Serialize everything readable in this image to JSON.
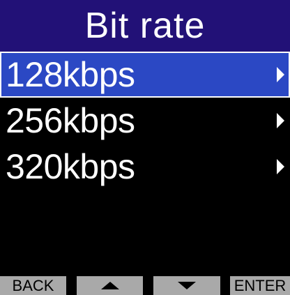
{
  "header": {
    "title": "Bit rate"
  },
  "menu": {
    "items": [
      {
        "label": "128kbps",
        "selected": true
      },
      {
        "label": "256kbps",
        "selected": false
      },
      {
        "label": "320kbps",
        "selected": false
      }
    ]
  },
  "softkeys": {
    "back_label": "BACK",
    "up_icon": "up-arrow",
    "down_icon": "down-arrow",
    "enter_label": "ENTER"
  },
  "colors": {
    "header_bg": "#221177",
    "selection_bg": "#2b48c4",
    "softkey_bg": "#a9a9a9",
    "screen_bg": "#000000",
    "text": "#ffffff"
  }
}
